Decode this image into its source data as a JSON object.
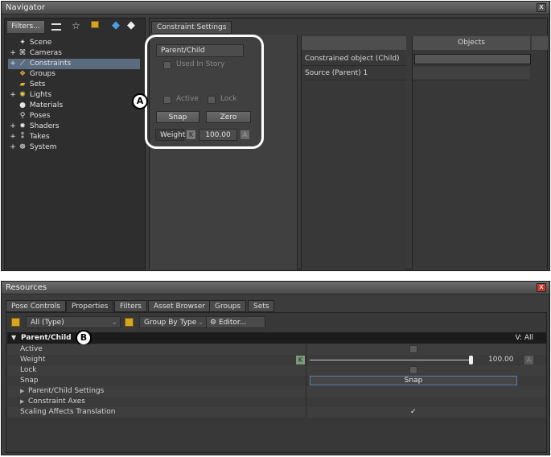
{
  "navigator": {
    "title": "Navigator",
    "close_label": "x",
    "filters_label": "Filters...",
    "tree": [
      {
        "label": "Scene",
        "icon": "scene-icon",
        "glyph": "✦",
        "expand": ""
      },
      {
        "label": "Cameras",
        "icon": "camera-icon",
        "glyph": "⌘",
        "expand": "+"
      },
      {
        "label": "Constraints",
        "icon": "constraint-icon",
        "glyph": "⟋",
        "expand": "+"
      },
      {
        "label": "Groups",
        "icon": "groups-icon",
        "glyph": "❖",
        "expand": ""
      },
      {
        "label": "Sets",
        "icon": "folder-icon",
        "glyph": "▰",
        "expand": ""
      },
      {
        "label": "Lights",
        "icon": "light-icon",
        "glyph": "✺",
        "expand": "+"
      },
      {
        "label": "Materials",
        "icon": "material-icon",
        "glyph": "●",
        "expand": ""
      },
      {
        "label": "Poses",
        "icon": "pose-icon",
        "glyph": "⚲",
        "expand": ""
      },
      {
        "label": "Shaders",
        "icon": "shader-icon",
        "glyph": "✹",
        "expand": "+"
      },
      {
        "label": "Takes",
        "icon": "takes-icon",
        "glyph": "⁑",
        "expand": "+"
      },
      {
        "label": "System",
        "icon": "system-icon",
        "glyph": "☸",
        "expand": "+"
      }
    ],
    "constraint_tab": "Constraint Settings",
    "constraint_type": "Parent/Child",
    "used_in_story": "Used In Story",
    "active_label": "Active",
    "lock_label": "Lock",
    "snap_label": "Snap",
    "zero_label": "Zero",
    "weight_label": "Weight",
    "weight_key": "K",
    "weight_value": "100.00",
    "weight_anim": "A",
    "constrained_object": "Constrained object (Child)",
    "source": "Source (Parent) 1",
    "objects_header": "Objects",
    "callout_a": "A"
  },
  "resources": {
    "title": "Resources",
    "close_label": "x",
    "tabs": [
      "Pose Controls",
      "Properties",
      "Filters",
      "Asset Browser",
      "Groups",
      "Sets"
    ],
    "type_filter": "All (Type)",
    "group_by": "Group By Type",
    "editor_label": "Editor...",
    "section_title": "Parent/Child",
    "view_all": "V: All",
    "callout_b": "B",
    "rows": {
      "active": "Active",
      "weight": "Weight",
      "lock": "Lock",
      "snap": "Snap",
      "parent_child_settings": "Parent/Child Settings",
      "constraint_axes": "Constraint Axes",
      "scaling": "Scaling Affects Translation"
    },
    "weight_key": "K",
    "weight_value": "100.00",
    "weight_anim": "A",
    "snap_button": "Snap",
    "scaling_check": "✓",
    "weight_fraction": 1.0
  }
}
